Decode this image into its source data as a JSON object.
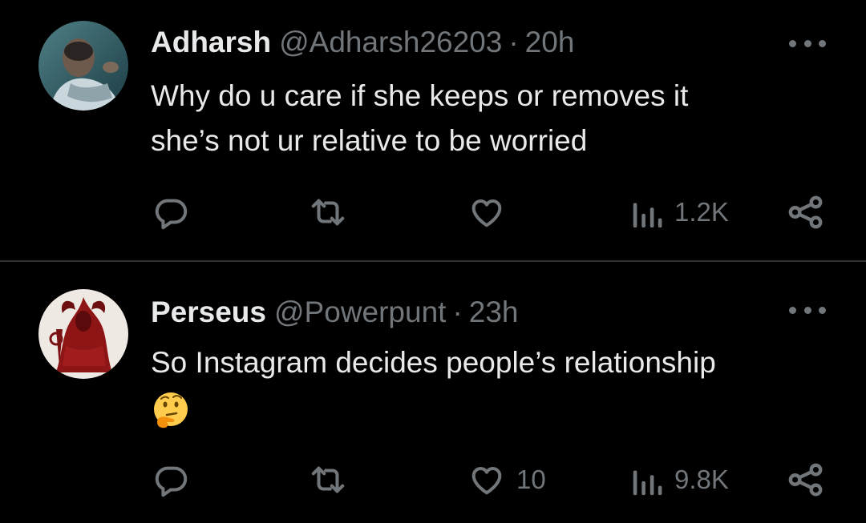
{
  "tweets": [
    {
      "display_name": "Adharsh",
      "handle": "@Adharsh26203",
      "separator": "·",
      "time": "20h",
      "text_lines": [
        "Why do u care if she keeps or removes it",
        "she’s not ur relative to be worried"
      ],
      "emoji": "",
      "actions": {
        "reply_icon": "reply-icon",
        "retweet_icon": "retweet-icon",
        "like_icon": "heart-icon",
        "like_count": "",
        "views_icon": "views-icon",
        "views_count": "1.2K",
        "share_icon": "share-icon"
      }
    },
    {
      "display_name": "Perseus",
      "handle": "@Powerpunt",
      "separator": "·",
      "time": "23h",
      "text_lines": [
        "So Instagram decides people’s relationship"
      ],
      "emoji": "thinking-face-emoji",
      "actions": {
        "reply_icon": "reply-icon",
        "retweet_icon": "retweet-icon",
        "like_icon": "heart-icon",
        "like_count": "10",
        "views_icon": "views-icon",
        "views_count": "9.8K",
        "share_icon": "share-icon"
      }
    }
  ],
  "colors": {
    "background": "#000000",
    "primary_text": "#e7e9ea",
    "secondary_text": "#71767b",
    "divider": "#2f3336"
  }
}
